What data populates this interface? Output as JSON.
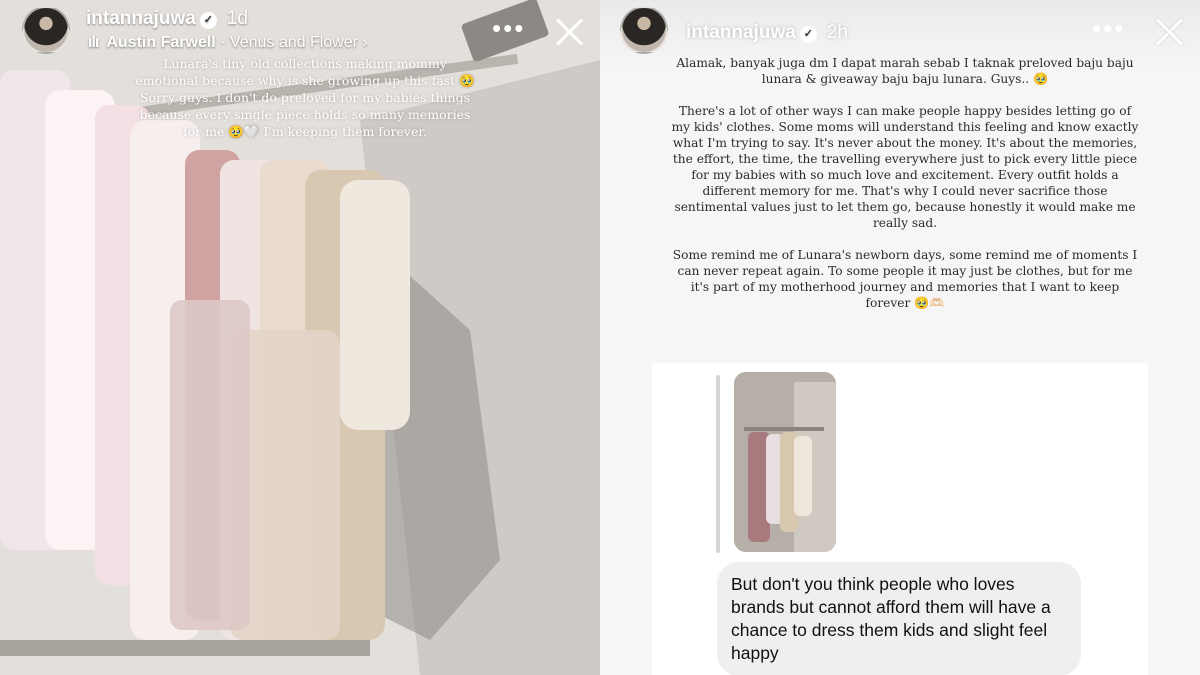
{
  "left_story": {
    "username": "intannajuwa",
    "time": "1d",
    "music": {
      "artist": "Austin Farwell",
      "song": "Venus and Flower",
      "chevron": "›"
    },
    "caption_lines": [
      "Lunara's tiny old collections making mommy",
      "emotional because why is she growing up this fast 🥹",
      "Sorry guys. I don't do preloved for my babies things",
      "because every single piece holds so many memories",
      "for me 🥹🤍 I'm keeping them forever."
    ],
    "icons": [
      "avatar",
      "verified-icon",
      "music-bars-icon",
      "more-icon",
      "close-icon"
    ]
  },
  "right_story": {
    "username": "intannajuwa",
    "time": "2h",
    "message_paragraphs": [
      "Alamak, banyak juga dm I dapat marah sebab I taknak preloved baju baju lunara & giveaway baju baju lunara. Guys.. 🥹",
      "There's a lot of other ways I can make people happy besides letting go of my kids' clothes. Some moms will understand this feeling and know exactly what I'm trying to say. It's never about the money. It's about the memories, the effort, the time, the travelling everywhere just to pick every little piece for my babies with so much love and excitement. Every outfit holds a different memory for me. That's why I could never sacrifice those sentimental values just to let them go, because honestly it would make me really sad.",
      "Some remind me of Lunara's newborn days, some remind me of moments I can never repeat again. To some people it may just be clothes, but for me it's part of my motherhood journey and memories that I want to keep forever 🥹🫶🏻"
    ],
    "reply_bubble": "But don't you think people who loves brands but cannot afford them will have a chance to dress them kids and slight feel happy"
  },
  "ui": {
    "more_glyph": "•••"
  }
}
